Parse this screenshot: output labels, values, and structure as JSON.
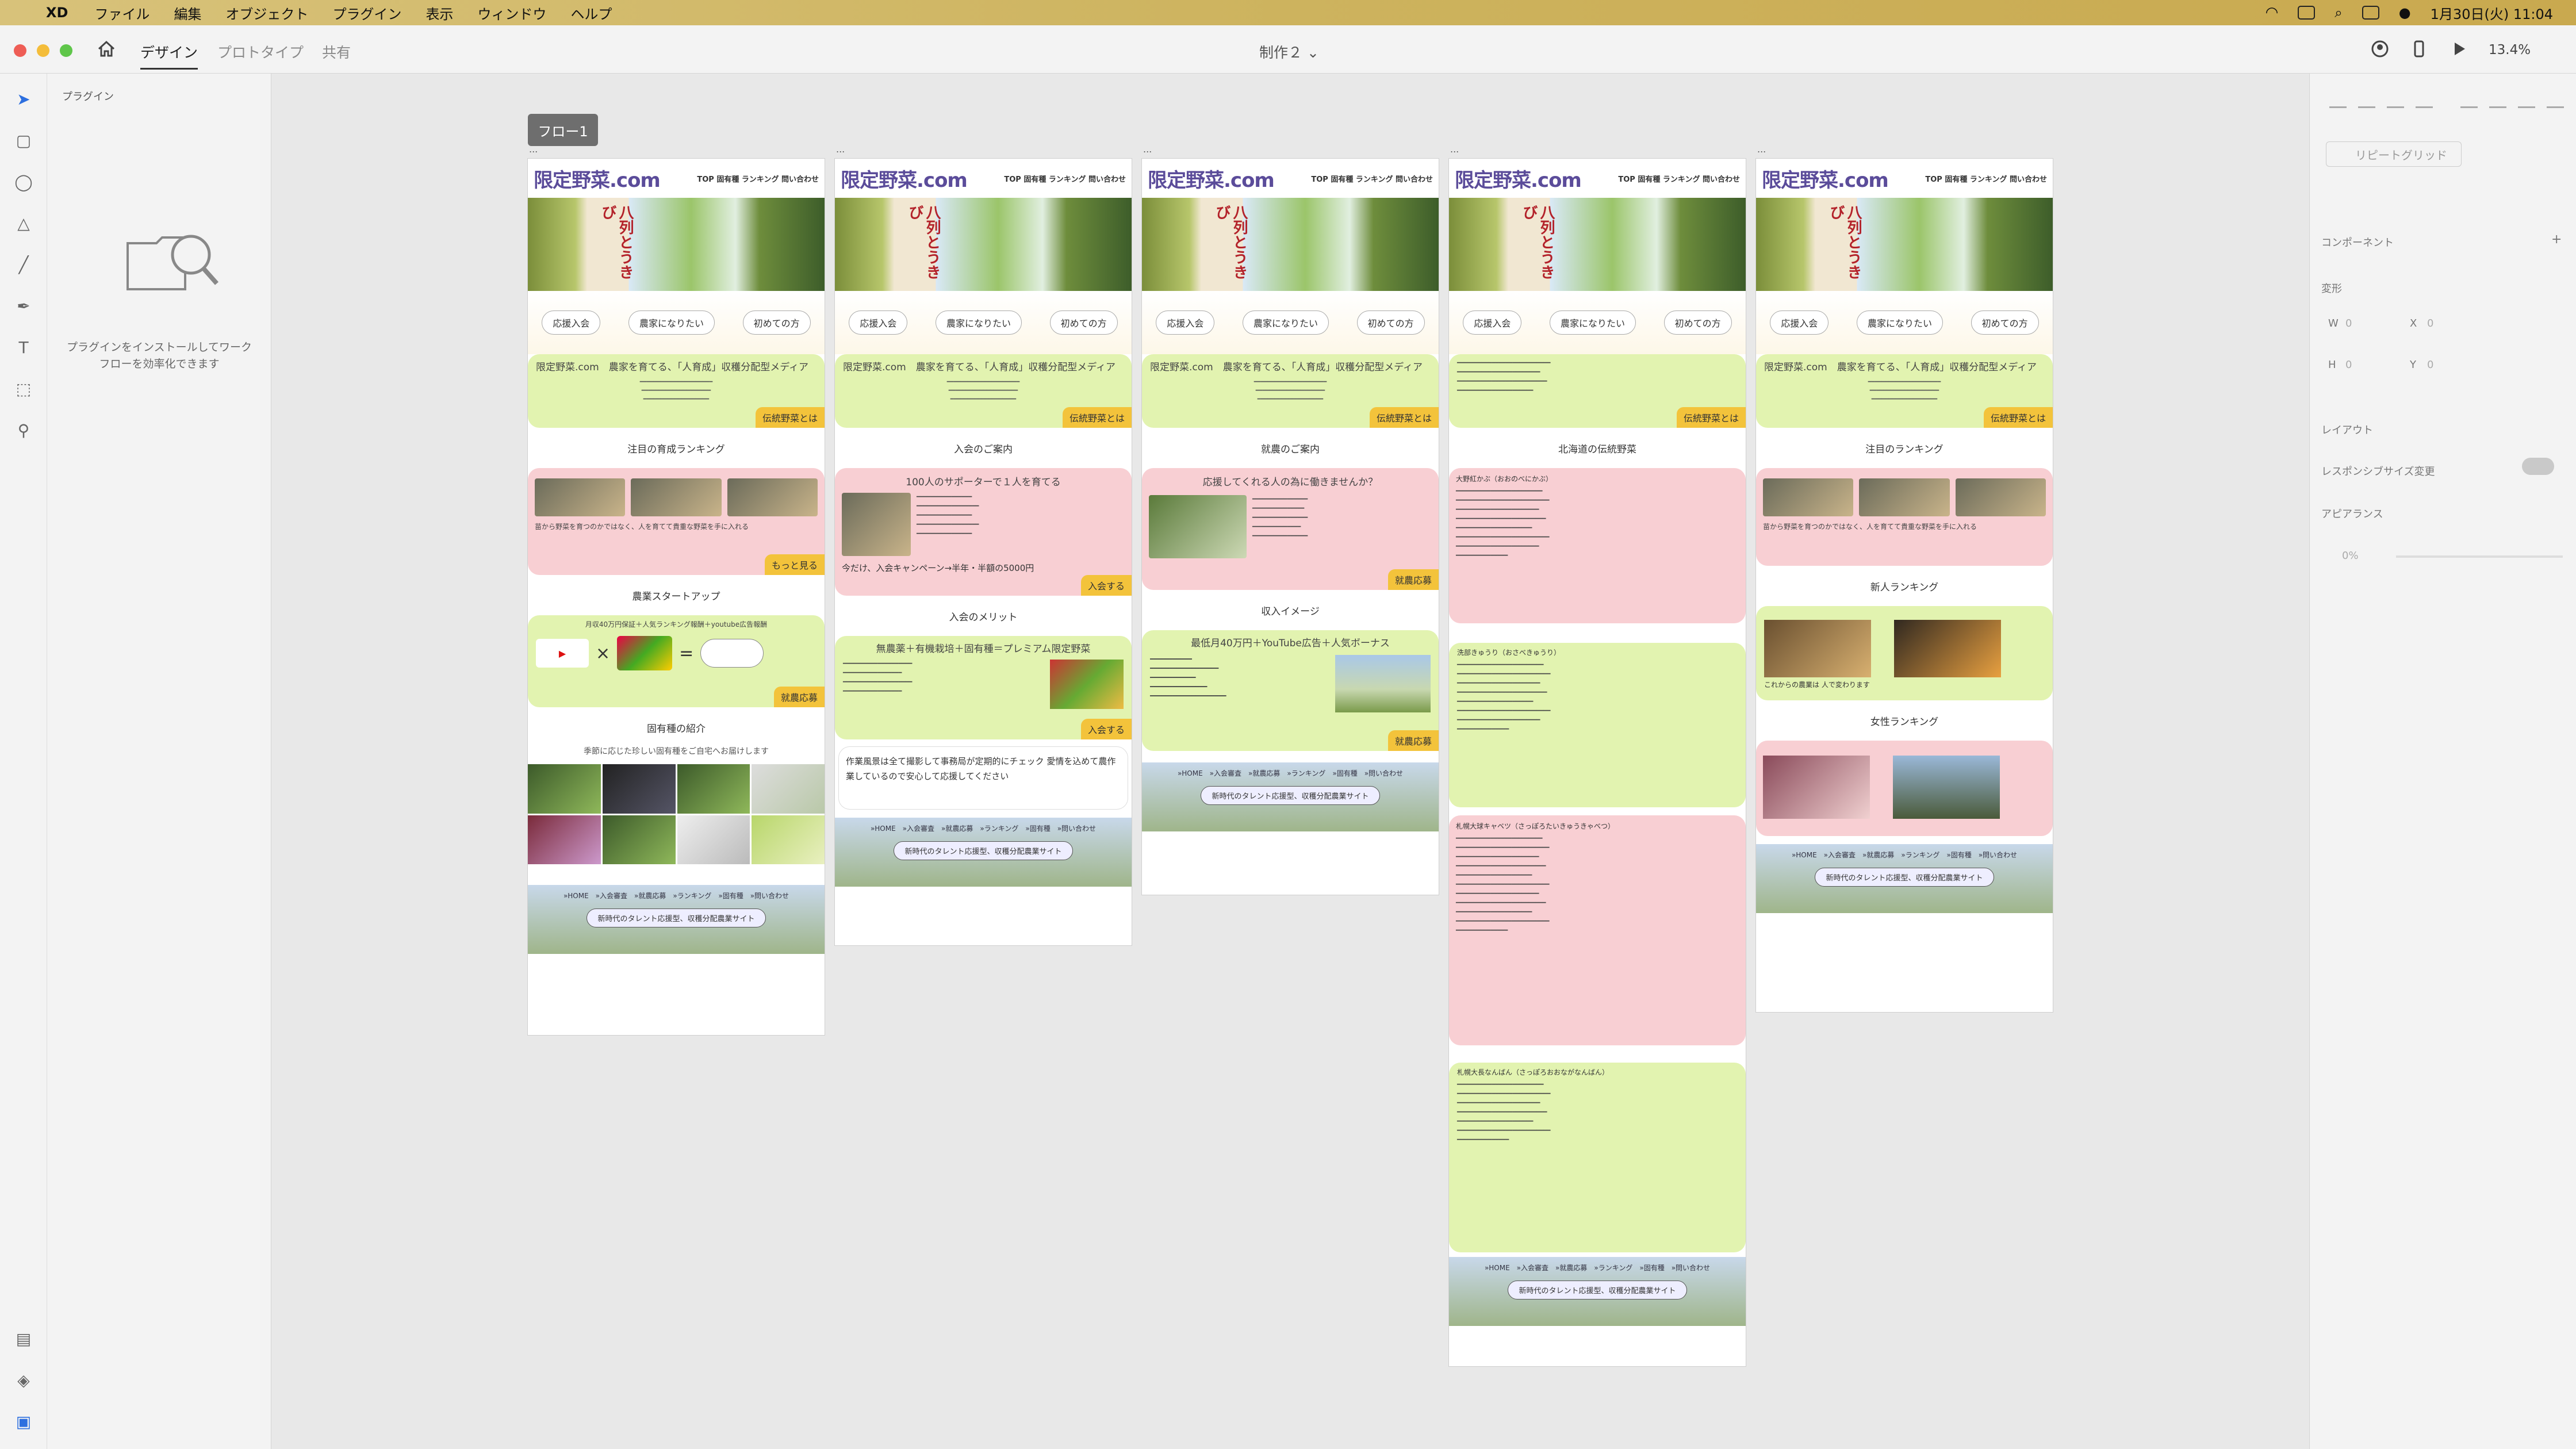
{
  "menubar": {
    "app": "XD",
    "items": [
      "ファイル",
      "編集",
      "オブジェクト",
      "プラグイン",
      "表示",
      "ウィンドウ",
      "ヘルプ"
    ],
    "datetime": "1月30日(火) 11:04"
  },
  "toolbar": {
    "tabs": [
      "デザイン",
      "プロトタイプ",
      "共有"
    ],
    "doc_title": "制作２",
    "zoom": "13.4%"
  },
  "plugins": {
    "title": "プラグイン",
    "message": "プラグインをインストールしてワークフローを効率化できます"
  },
  "canvas": {
    "flow_label": "フロー1",
    "artboards": [
      {
        "logo": "限定野菜.com",
        "nav": "TOP 固有種 ランキング 問い合わせ",
        "hero_text": "八列とうきび",
        "pills": [
          "応援入会",
          "農家になりたい",
          "初めての方"
        ],
        "intro_title": "限定野菜.com　農家を育てる、「人育成」収穫分配型メディア",
        "intro_tag": "伝統野菜とは",
        "sections": [
          {
            "title": "注目の育成ランキング",
            "box": "pink",
            "caption": "苗から野菜を育つのかではなく、人を育てて貴重な野菜を手に入れる",
            "tag": "もっと見る"
          },
          {
            "title": "農業スタートアップ",
            "box": "green",
            "caption": "月収40万円保証＋人気ランキング報酬＋youtube広告報酬",
            "tag": "就農応募"
          },
          {
            "title": "固有種の紹介",
            "box": "veg",
            "caption": "季節に応じた珍しい固有種をご自宅へお届けします",
            "tag": ""
          }
        ],
        "footer_links": "»HOME　»入会審査　»就農応募　»ランキング　»固有種　»問い合わせ",
        "footer_btn": "新時代のタレント応援型、収穫分配農業サイト"
      },
      {
        "logo": "限定野菜.com",
        "nav": "TOP 固有種 ランキング 問い合わせ",
        "hero_text": "八列とうきび",
        "pills": [
          "応援入会",
          "農家になりたい",
          "初めての方"
        ],
        "intro_title": "限定野菜.com　農家を育てる、「人育成」収穫分配型メディア",
        "intro_tag": "伝統野菜とは",
        "sections": [
          {
            "title": "入会のご案内",
            "box": "pink",
            "caption": "100人のサポーターで１人を育てる",
            "tag": "入会する",
            "extra": "今だけ、入会キャンペーン→半年・半額の5000円"
          },
          {
            "title": "入会のメリット",
            "box": "green",
            "caption": "無農薬＋有機栽培＋固有種＝プレミアム限定野菜",
            "tag": "入会する"
          },
          {
            "title": "",
            "box": "white",
            "caption": "作業風景は全て撮影して事務局が定期的にチェック 愛情を込めて農作業しているので安心して応援してください",
            "tag": ""
          }
        ],
        "footer_links": "»HOME　»入会審査　»就農応募　»ランキング　»固有種　»問い合わせ",
        "footer_btn": "新時代のタレント応援型、収穫分配農業サイト"
      },
      {
        "logo": "限定野菜.com",
        "nav": "TOP 固有種 ランキング 問い合わせ",
        "hero_text": "八列とうきび",
        "pills": [
          "応援入会",
          "農家になりたい",
          "初めての方"
        ],
        "intro_title": "限定野菜.com　農家を育てる、「人育成」収穫分配型メディア",
        "intro_tag": "伝統野菜とは",
        "sections": [
          {
            "title": "就農のご案内",
            "box": "pink",
            "caption": "応援してくれる人の為に働きませんか？",
            "tag": "就農応募"
          },
          {
            "title": "収入イメージ",
            "box": "green",
            "caption": "最低月40万円＋YouTube広告＋人気ボーナス",
            "tag": "就農応募"
          }
        ],
        "footer_links": "»HOME　»入会審査　»就農応募　»ランキング　»固有種　»問い合わせ",
        "footer_btn": "新時代のタレント応援型、収穫分配農業サイト"
      },
      {
        "logo": "限定野菜.com",
        "nav": "TOP 固有種 ランキング 問い合わせ",
        "hero_text": "八列とうきび",
        "pills": [
          "応援入会",
          "農家になりたい",
          "初めての方"
        ],
        "intro_title": "",
        "intro_tag": "伝統野菜とは",
        "sections": [
          {
            "title": "北海道の伝統野菜",
            "box": "pink",
            "caption": "大野紅かぶ（おおのべにかぶ）",
            "tag": ""
          },
          {
            "title": "",
            "box": "green",
            "caption": "洗部きゅうり（おさべきゅうり）",
            "tag": ""
          },
          {
            "title": "",
            "box": "pink",
            "caption": "札幌大球キャベツ（さっぽろたいきゅうきゃべつ）",
            "tag": ""
          },
          {
            "title": "",
            "box": "green",
            "caption": "札幌大長なんばん（さっぽろおおながなんばん）",
            "tag": ""
          }
        ],
        "footer_links": "»HOME　»入会審査　»就農応募　»ランキング　»固有種　»問い合わせ",
        "footer_btn": "新時代のタレント応援型、収穫分配農業サイト"
      },
      {
        "logo": "限定野菜.com",
        "nav": "TOP 固有種 ランキング 問い合わせ",
        "hero_text": "八列とうきび",
        "pills": [
          "応援入会",
          "農家になりたい",
          "初めての方"
        ],
        "intro_title": "限定野菜.com　農家を育てる、「人育成」収穫分配型メディア",
        "intro_tag": "伝統野菜とは",
        "sections": [
          {
            "title": "注目のランキング",
            "box": "pink",
            "caption": "苗から野菜を育つのかではなく、人を育てて貴重な野菜を手に入れる",
            "tag": ""
          },
          {
            "title": "新人ランキング",
            "box": "green",
            "caption": "これからの農業は 人で変わります",
            "tag": ""
          },
          {
            "title": "女性ランキング",
            "box": "pink",
            "caption": "",
            "tag": ""
          }
        ],
        "footer_links": "»HOME　»入会審査　»就農応募　»ランキング　»固有種　»問い合わせ",
        "footer_btn": "新時代のタレント応援型、収穫分配農業サイト"
      }
    ]
  },
  "inspector": {
    "repeat_grid": "リピートグリッド",
    "component": "コンポーネント",
    "transform": "変形",
    "w": "W",
    "w_val": "0",
    "x": "X",
    "x_val": "0",
    "h": "H",
    "h_val": "0",
    "y": "Y",
    "y_val": "0",
    "layout": "レイアウト",
    "responsive": "レスポンシブサイズ変更",
    "appearance": "アピアランス",
    "opacity": "0%"
  }
}
